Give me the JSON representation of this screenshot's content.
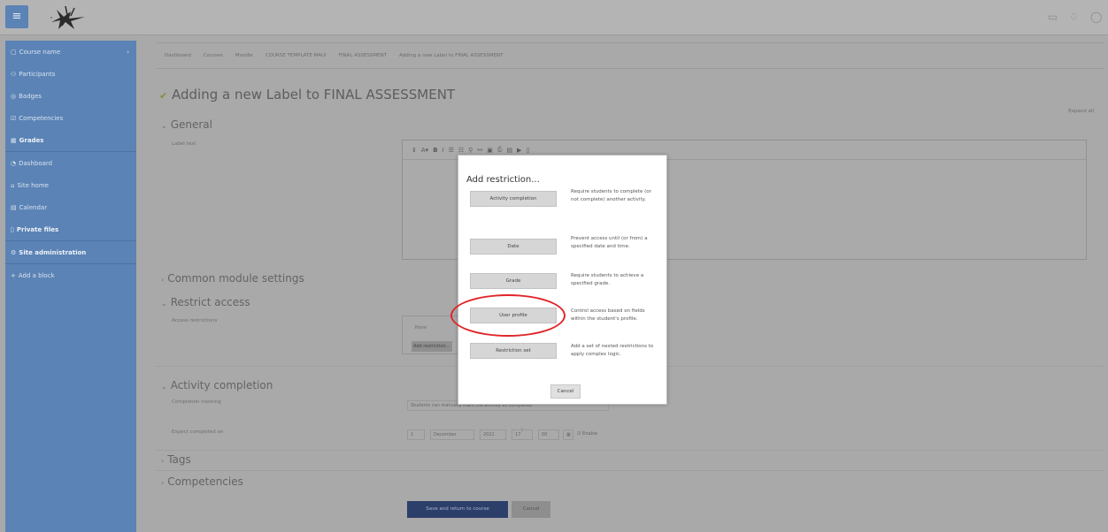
{
  "header": {
    "menu_icon": "hamburger-icon",
    "icons": [
      "chat-icon",
      "bell-icon",
      "user-icon"
    ]
  },
  "sidebar": {
    "items": [
      {
        "label": "Course name",
        "icon": "graduation-cap-icon",
        "bold": false,
        "toggle": true
      },
      {
        "label": "Participants",
        "icon": "users-icon",
        "bold": false
      },
      {
        "label": "Badges",
        "icon": "badge-icon",
        "bold": false
      },
      {
        "label": "Competencies",
        "icon": "checklist-icon",
        "bold": false
      },
      {
        "label": "Grades",
        "icon": "grades-icon",
        "bold": true
      },
      {
        "label": "Dashboard",
        "icon": "dashboard-icon",
        "bold": false
      },
      {
        "label": "Site home",
        "icon": "home-icon",
        "bold": false
      },
      {
        "label": "Calendar",
        "icon": "calendar-icon",
        "bold": false
      },
      {
        "label": "Private files",
        "icon": "file-icon",
        "bold": true
      },
      {
        "label": "Site administration",
        "icon": "cog-icon",
        "bold": true
      },
      {
        "label": "Add a block",
        "icon": "plus-icon",
        "bold": false
      }
    ]
  },
  "breadcrumb": [
    "Dashboard",
    "Courses",
    "Moodle",
    "COURSE TEMPLATE MAUI",
    "FINAL ASSESSMENT",
    "Adding a new Label to FINAL ASSESSMENT"
  ],
  "page": {
    "title": "Adding a new Label to FINAL ASSESSMENT",
    "expand_all": "Expand all"
  },
  "form": {
    "general": "General",
    "label_text": "Label text",
    "common_module": "Common module settings",
    "restrict_access": "Restrict access",
    "access_restrictions": "Access restrictions",
    "restrict_none": "None",
    "add_restriction_btn": "Add restriction...",
    "activity_completion": "Activity completion",
    "completion_tracking": "Completion tracking",
    "completion_value": "Students can manually mark the activity as completed",
    "expect_completed": "Expect completed on",
    "date_fields": [
      "1",
      "December",
      "2021",
      "17",
      "00"
    ],
    "enable": "Enable",
    "tags": "Tags",
    "competencies": "Competencies",
    "save_return": "Save and return to course",
    "cancel": "Cancel"
  },
  "modal": {
    "title": "Add restriction...",
    "options": [
      {
        "button": "Activity completion",
        "description": "Require students to complete (or not complete) another activity."
      },
      {
        "button": "Date",
        "description": "Prevent access until (or from) a specified date and time."
      },
      {
        "button": "Grade",
        "description": "Require students to achieve a specified grade."
      },
      {
        "button": "User profile",
        "description": "Control access based on fields within the student's profile."
      },
      {
        "button": "Restriction set",
        "description": "Add a set of nested restrictions to apply complex logic."
      }
    ],
    "cancel": "Cancel"
  },
  "colors": {
    "sidebar": "#5b83b5",
    "highlight": "#e0262a",
    "save_button": "#2c3e6a"
  }
}
